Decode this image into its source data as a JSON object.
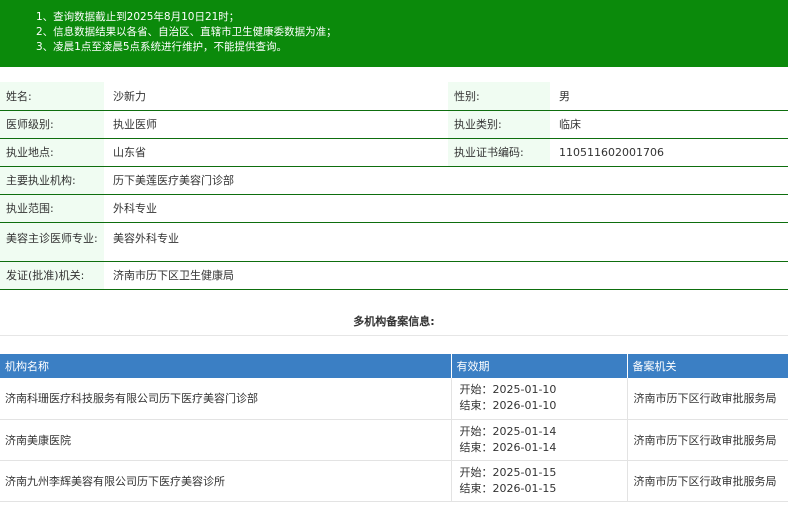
{
  "notice": {
    "lines": [
      "1、查询数据截止到2025年8月10日21时；",
      "2、信息数据结果以各省、自治区、直辖市卫生健康委数据为准；",
      "3、凌晨1点至凌晨5点系统进行维护，不能提供查询。"
    ]
  },
  "doctor": {
    "name_label": "姓名:",
    "name": "沙新力",
    "gender_label": "性别:",
    "gender": "男",
    "level_label": "医师级别:",
    "level": "执业医师",
    "category_label": "执业类别:",
    "category": "临床",
    "location_label": "执业地点:",
    "location": "山东省",
    "cert_label": "执业证书编码:",
    "cert": "110511602001706",
    "institution_label": "主要执业机构:",
    "institution": "历下美莲医疗美容门诊部",
    "scope_label": "执业范围:",
    "scope": "外科专业",
    "cosmetic_label": "美容主诊医师专业:",
    "cosmetic": "美容外科专业",
    "issuer_label": "发证(批准)机关:",
    "issuer": "济南市历下区卫生健康局"
  },
  "multi": {
    "title": "多机构备案信息:",
    "headers": {
      "org": "机构名称",
      "period": "有效期",
      "agency": "备案机关"
    },
    "start_label": "开始：",
    "end_label": "结束：",
    "rows": [
      {
        "org": "济南科珊医疗科技服务有限公司历下医疗美容门诊部",
        "start": "2025-01-10",
        "end": "2026-01-10",
        "agency": "济南市历下区行政审批服务局"
      },
      {
        "org": "济南美康医院",
        "start": "2025-01-14",
        "end": "2026-01-14",
        "agency": "济南市历下区行政审批服务局"
      },
      {
        "org": "济南九州李辉美容有限公司历下医疗美容诊所",
        "start": "2025-01-15",
        "end": "2026-01-15",
        "agency": "济南市历下区行政审批服务局"
      }
    ]
  },
  "colors": {
    "notice_bg": "#0b8a0b",
    "header_bg": "#3b7fc4",
    "label_bg": "#f0fcf2",
    "divider": "#0e6e0e"
  }
}
